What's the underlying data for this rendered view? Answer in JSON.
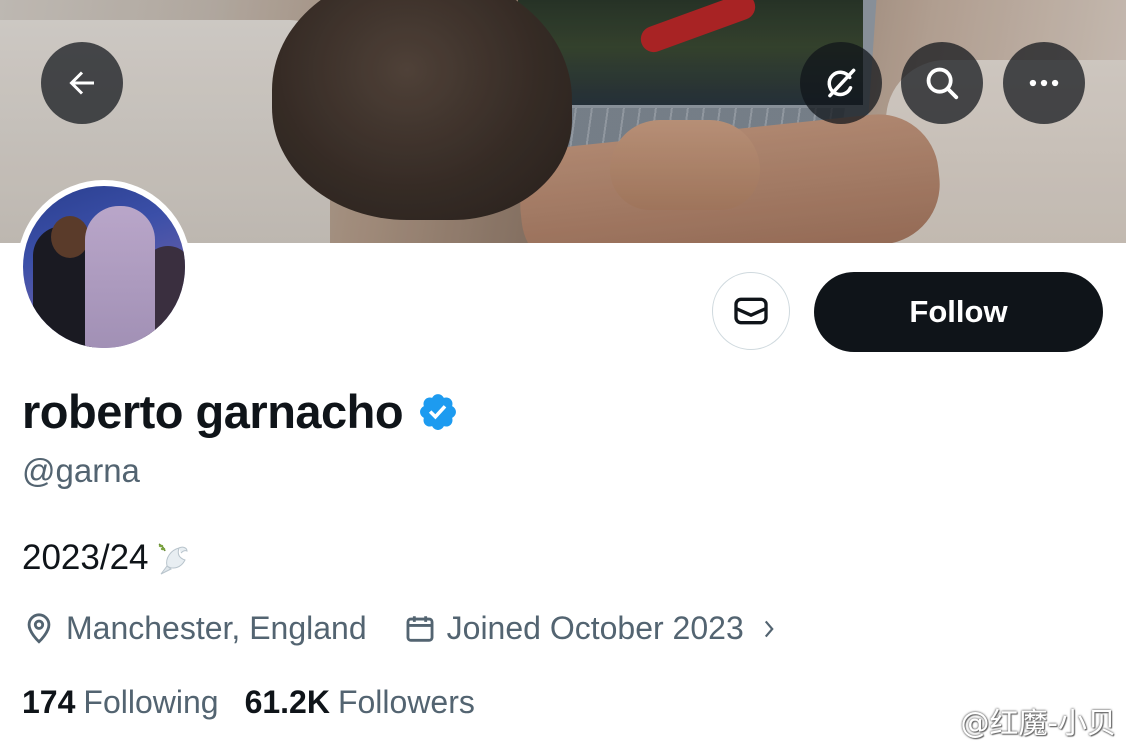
{
  "profile": {
    "display_name": "roberto garnacho",
    "handle": "@garna",
    "bio_text": "2023/24",
    "bio_emoji": "dove-emoji",
    "location": "Manchester, England",
    "joined": "Joined October 2023",
    "following_count": "174",
    "following_label": "Following",
    "followers_count": "61.2K",
    "followers_label": "Followers"
  },
  "actions": {
    "follow_label": "Follow",
    "message_icon": "envelope-icon"
  },
  "top_bar": {
    "back_icon": "back-arrow-icon",
    "grok_icon": "grok-icon",
    "search_icon": "search-icon",
    "more_icon": "more-icon"
  },
  "watermark": {
    "text": "@红魔-小贝",
    "logo": "weibo-logo"
  },
  "colors": {
    "verified": "#1d9bf0",
    "primary_text": "#0f1419",
    "secondary_text": "#536471",
    "follow_button_bg": "#0f1419"
  }
}
